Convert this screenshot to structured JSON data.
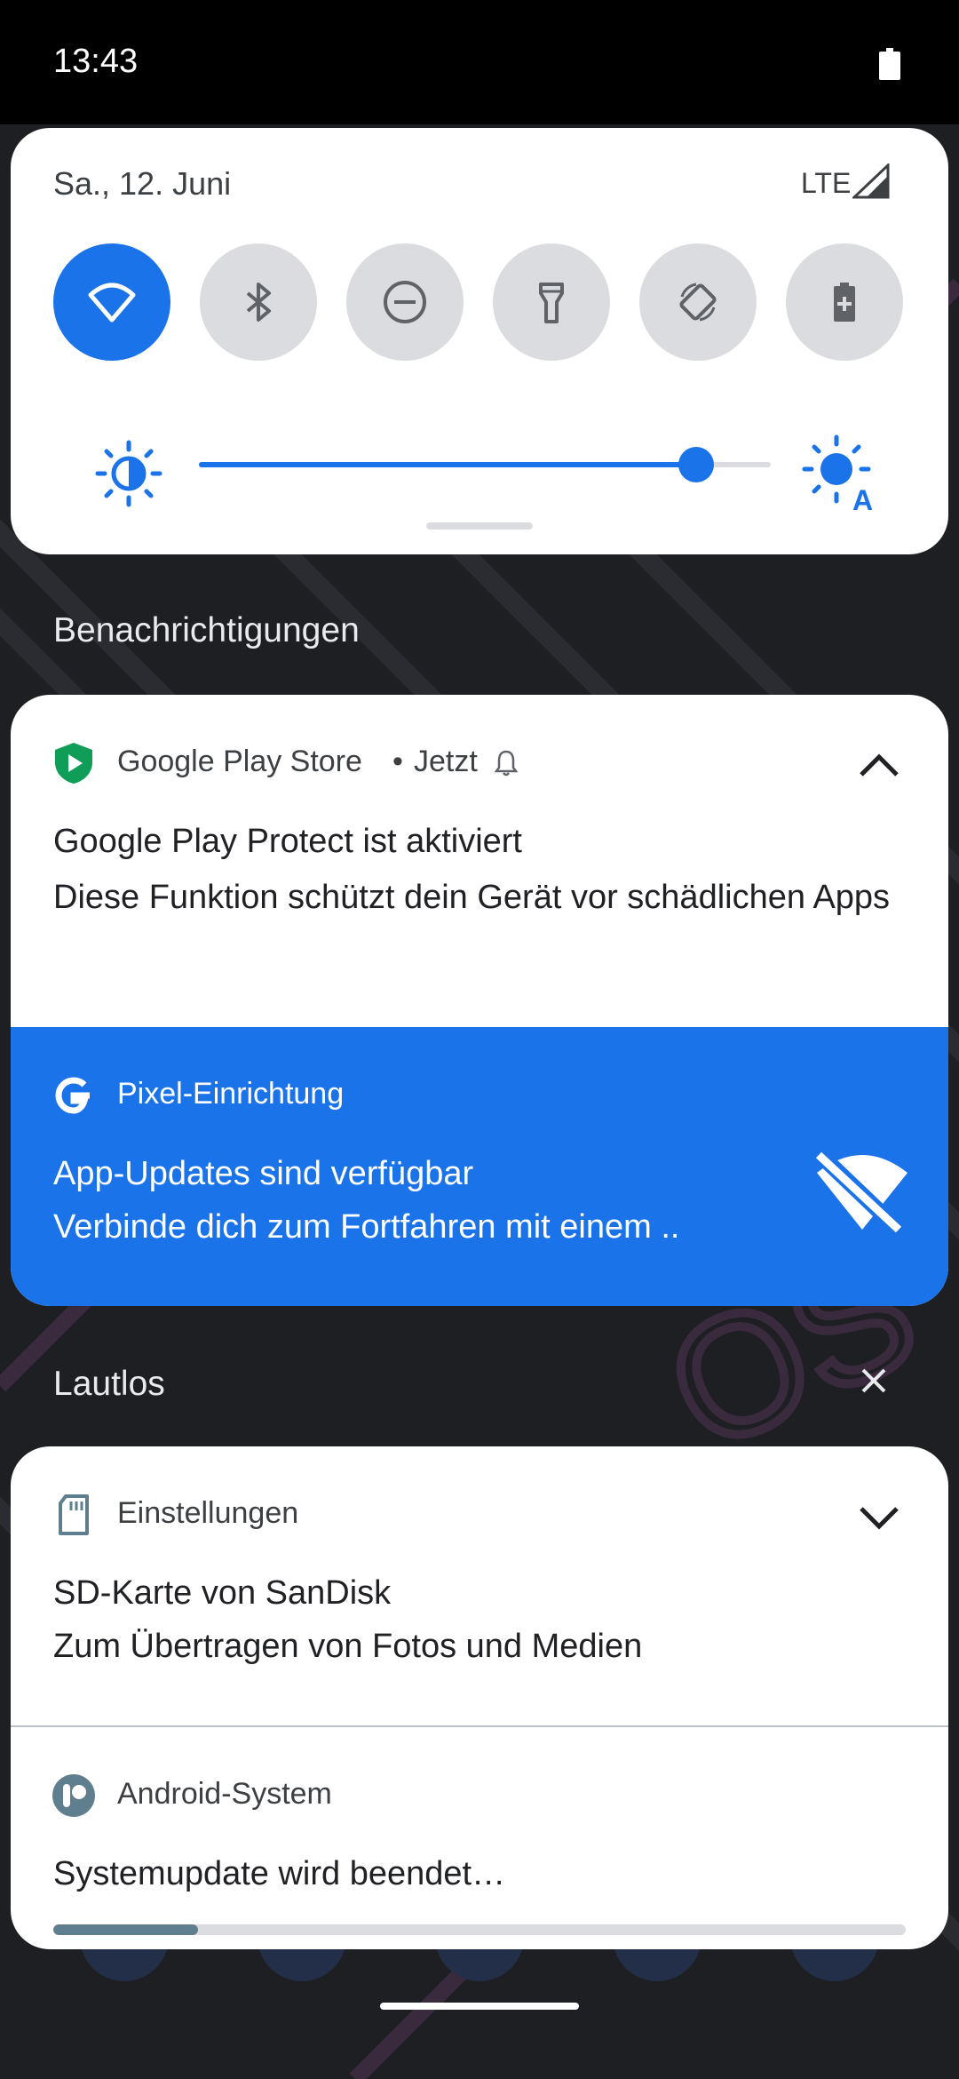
{
  "status_bar": {
    "time": "13:43"
  },
  "quick_settings": {
    "date": "Sa., 12. Juni",
    "network": "LTE",
    "tiles": [
      {
        "icon": "wifi-icon",
        "state": "on"
      },
      {
        "icon": "bluetooth-icon",
        "state": "off"
      },
      {
        "icon": "do-not-disturb-icon",
        "state": "off"
      },
      {
        "icon": "flashlight-icon",
        "state": "off"
      },
      {
        "icon": "auto-rotate-icon",
        "state": "off"
      },
      {
        "icon": "battery-saver-icon",
        "state": "off"
      }
    ],
    "brightness_level": 0.87,
    "accent_color": "#1a73e8"
  },
  "sections": {
    "notifications_title": "Benachrichtigungen",
    "silent_title": "Lautlos"
  },
  "notifications": {
    "play_store": {
      "app": "Google Play Store",
      "time": "Jetzt",
      "title": "Google Play Protect ist aktiviert",
      "text": "Diese Funktion schützt dein Gerät vor schädlichen Apps"
    },
    "pixel_setup": {
      "app": "Pixel-Einrichtung",
      "title": "App-Updates sind verfügbar",
      "text": "Verbinde dich zum Fortfahren mit einem ..",
      "color": "#1a73e8"
    },
    "settings": {
      "app": "Einstellungen",
      "title": "SD-Karte von SanDisk",
      "text": "Zum Übertragen von Fotos und Medien"
    },
    "android_system": {
      "app": "Android-System",
      "title": "Systemupdate wird beendet…",
      "progress": 0.17
    }
  }
}
